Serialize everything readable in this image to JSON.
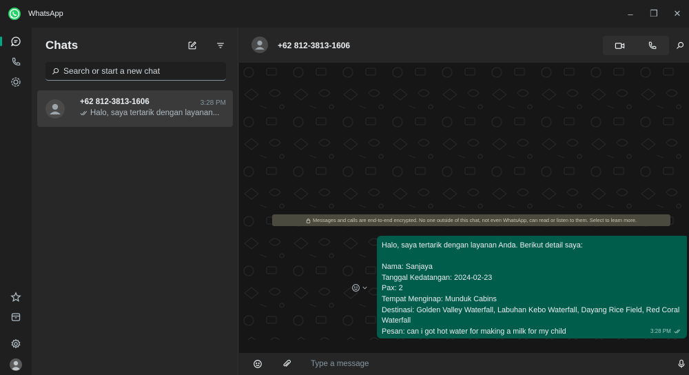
{
  "app": {
    "title": "WhatsApp"
  },
  "window_controls": {
    "minimize": "–",
    "restore": "❐",
    "close": "✕"
  },
  "sidebar_rail": {
    "icons": [
      "chats-icon",
      "calls-icon",
      "status-icon",
      "starred-icon",
      "archive-icon",
      "settings-icon",
      "profile-avatar"
    ]
  },
  "chat_list": {
    "title": "Chats",
    "search_placeholder": "Search or start a new chat",
    "items": [
      {
        "name": "+62 812-3813-1606",
        "time": "3:28 PM",
        "preview": "Halo, saya tertarik dengan layanan..."
      }
    ]
  },
  "conversation": {
    "contact_name": "+62 812-3813-1606",
    "encryption_notice": "Messages and calls are end-to-end encrypted. No one outside of this chat, not even WhatsApp, can read or listen to them. Select to learn more.",
    "message": {
      "lines": [
        "Halo, saya tertarik dengan layanan Anda. Berikut detail saya:",
        "",
        "Nama: Sanjaya",
        "Tanggal Kedatangan: 2024-02-23",
        "Pax: 2",
        "Tempat Menginap: Munduk Cabins",
        "Destinasi: Golden Valley Waterfall, Labuhan Kebo Waterfall, Dayang Rice Field, Red Coral Waterfall",
        "Pesan: can i got hot water for making a milk for my child"
      ],
      "time": "3:28 PM"
    },
    "composer_placeholder": "Type a message"
  },
  "colors": {
    "accent": "#00a884",
    "bubble_outgoing": "#005c4b",
    "app_bg": "#1f1f1f",
    "panel_bg": "#272727",
    "notice_bg": "#4b4a3e"
  }
}
